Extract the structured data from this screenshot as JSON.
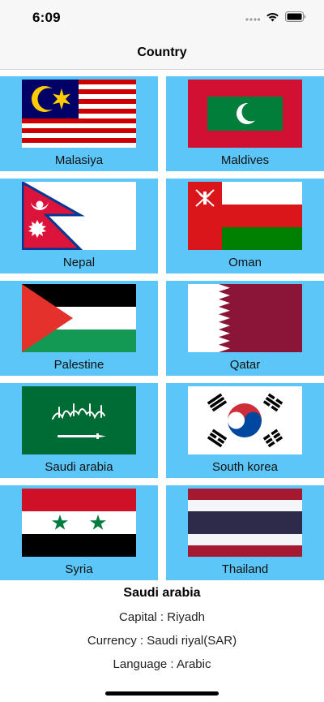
{
  "status_bar": {
    "time": "6:09",
    "icons": [
      "signal-dots-icon",
      "wifi-icon",
      "battery-icon"
    ]
  },
  "nav": {
    "title": "Country"
  },
  "countries": [
    {
      "name": "Malasiya",
      "flag": "malaysia-flag"
    },
    {
      "name": "Maldives",
      "flag": "maldives-flag"
    },
    {
      "name": "Nepal",
      "flag": "nepal-flag"
    },
    {
      "name": "Oman",
      "flag": "oman-flag"
    },
    {
      "name": "Palestine",
      "flag": "palestine-flag"
    },
    {
      "name": "Qatar",
      "flag": "qatar-flag"
    },
    {
      "name": "Saudi arabia",
      "flag": "saudi-arabia-flag"
    },
    {
      "name": "South korea",
      "flag": "south-korea-flag"
    },
    {
      "name": "Syria",
      "flag": "syria-flag"
    },
    {
      "name": "Thailand",
      "flag": "thailand-flag"
    }
  ],
  "detail": {
    "name": "Saudi arabia",
    "capital_label": "Capital : ",
    "capital": "Riyadh",
    "currency_label": "Currency : ",
    "currency": "Saudi riyal(SAR)",
    "language_label": "Language : ",
    "language": "Arabic"
  },
  "colors": {
    "cell_background": "#5cc6f8",
    "bar_background": "#f7f7f7"
  }
}
